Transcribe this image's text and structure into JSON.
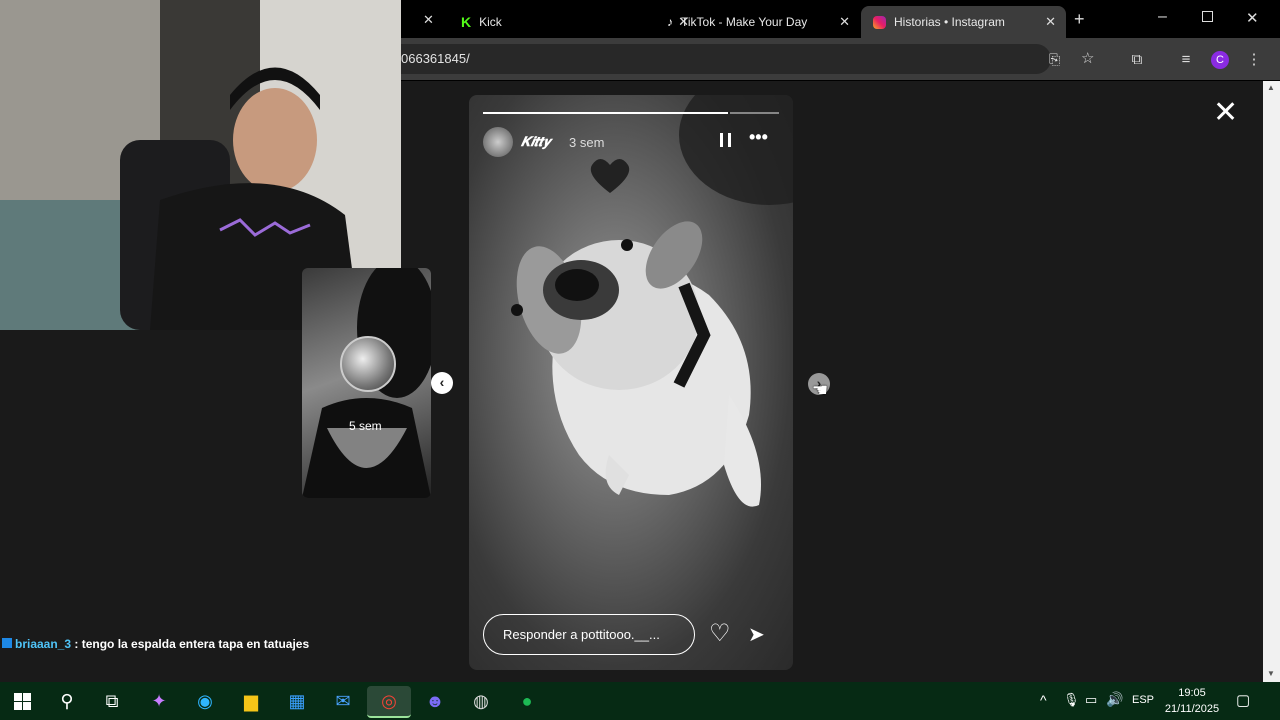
{
  "browser": {
    "tabs": [
      {
        "label": "Kick",
        "favicon": "kick-icon",
        "color": "#53fc18"
      },
      {
        "label": "TikTok - Make Your Day",
        "favicon": "tiktok-icon"
      },
      {
        "label": "Historias • Instagram",
        "favicon": "instagram-icon",
        "active": true
      }
    ],
    "url": "066361845/",
    "profile_initial": "C"
  },
  "story": {
    "username": "𝑲𝒊𝒕𝒕𝒚",
    "time": "3 sem",
    "reply_placeholder": "Responder a pottitooo.__...",
    "progress_segments": 18,
    "progress_filled": 15
  },
  "prev_story": {
    "time": "5 sem"
  },
  "chat": {
    "user": "briaaan_3",
    "message": ": tengo la espalda entera tapa en tatuajes"
  },
  "tray": {
    "lang": "ESP",
    "time": "19:05",
    "date": "21/11/2025"
  },
  "colors": {
    "accent": "#8a2be2",
    "taskbar": "#062a14",
    "chat_user": "#4fc3f7"
  }
}
